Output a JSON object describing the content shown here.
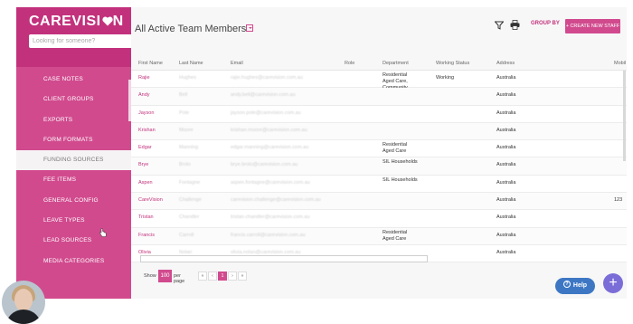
{
  "sidebar": {
    "logo": "CAREVISI",
    "logo_suffix": "N",
    "search_placeholder": "Looking for someone?",
    "items": [
      {
        "label": "CASE NOTES"
      },
      {
        "label": "CLIENT GROUPS"
      },
      {
        "label": "EXPORTS"
      },
      {
        "label": "FORM FORMATS"
      },
      {
        "label": "FUNDING SOURCES",
        "active": true
      },
      {
        "label": "FEE ITEMS"
      },
      {
        "label": "GENERAL CONFIG"
      },
      {
        "label": "LEAVE TYPES"
      },
      {
        "label": "LEAD SOURCES"
      },
      {
        "label": "MEDIA CATEGORIES"
      }
    ]
  },
  "header": {
    "title": "All Active Team Members",
    "group_by": "GROUP BY",
    "create_button": "+ CREATE NEW STAFF",
    "icons": [
      "filter-icon",
      "print-icon",
      "chevron-down-icon"
    ]
  },
  "table": {
    "columns": [
      "First Name",
      "Last Name",
      "Email",
      "Role",
      "Department",
      "Working Status",
      "Address",
      "Mobil"
    ],
    "rows": [
      {
        "first": "Rajie",
        "last": "Hughes",
        "email": "rajie.hughes@carevision.com.au",
        "dept": "Residential\nAged Care,\nCommunity",
        "status": "Working",
        "address": "Australia",
        "mobile": ""
      },
      {
        "first": "Andy",
        "last": "Bell",
        "email": "andy.bell@carevision.com.au",
        "dept": "",
        "status": "",
        "address": "Australia",
        "mobile": ""
      },
      {
        "first": "Jayson",
        "last": "Pole",
        "email": "jayson.pole@carevision.com.au",
        "dept": "",
        "status": "",
        "address": "Australia",
        "mobile": ""
      },
      {
        "first": "Krishan",
        "last": "Moore",
        "email": "krishan.moore@carevision.com.au",
        "dept": "",
        "status": "",
        "address": "Australia",
        "mobile": ""
      },
      {
        "first": "Edgar",
        "last": "Manning",
        "email": "edgar.manning@carevision.com.au",
        "dept": "Residential\nAged Care",
        "status": "",
        "address": "Australia",
        "mobile": ""
      },
      {
        "first": "Brye",
        "last": "Brolo",
        "email": "brye.brolo@carevision.com.au",
        "dept": "SIL Households",
        "status": "",
        "address": "Australia",
        "mobile": ""
      },
      {
        "first": "Aspen",
        "last": "Fontagne",
        "email": "aspen.fontagne@carevision.com.au",
        "dept": "SIL Households",
        "status": "",
        "address": "Australia",
        "mobile": ""
      },
      {
        "first": "CareVision",
        "last": "Challenge",
        "email": "carevision.challenge@carevision.com.au",
        "dept": "",
        "status": "",
        "address": "Australia",
        "mobile": "123"
      },
      {
        "first": "Tristan",
        "last": "Chandler",
        "email": "tristan.chandler@carevision.com.au",
        "dept": "",
        "status": "",
        "address": "Australia",
        "mobile": ""
      },
      {
        "first": "Francis",
        "last": "Carroll",
        "email": "francis.carroll@carevision.com.au",
        "dept": "Residential\nAged Care",
        "status": "",
        "address": "Australia",
        "mobile": ""
      },
      {
        "first": "Olivia",
        "last": "Nolan",
        "email": "olivia.nolan@carevision.com.au",
        "dept": "",
        "status": "",
        "address": "Australia",
        "mobile": ""
      }
    ]
  },
  "pager": {
    "show": "Show",
    "page_size": "100",
    "per_page": "per page",
    "first": "«",
    "prev": "‹",
    "current": "1",
    "next": "›",
    "last": "»"
  },
  "help_label": "Help",
  "add_label": "+",
  "colors": {
    "brand": "#d14a8e",
    "brand_dark": "#c2317c",
    "help": "#3d77c4",
    "add": "#7b6dd8"
  }
}
